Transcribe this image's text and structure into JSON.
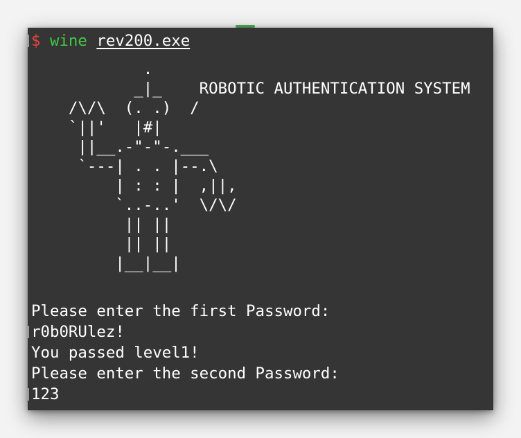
{
  "terminal": {
    "prompt_symbol": "$",
    "command": "wine",
    "argument": "rev200.exe",
    "banner_lines": [
      "            .",
      "           _|_    ROBOTIC AUTHENTICATION SYSTEM",
      "    /\\/\\  (. .)  /",
      "    `||'   |#|",
      "     ||__.-\"-\"-.___",
      "     `---| . . |--.\\",
      "         | : : |  ,||,",
      "         `..-..'  \\/\\/",
      "          || ||",
      "          || ||",
      "         |__|__|"
    ],
    "output_lines": [
      "Please enter the first Password:",
      "r0b0RUlez!",
      "You passed level1!",
      "Please enter the second Password:",
      "123"
    ]
  },
  "colors": {
    "terminal_bg": "#353535",
    "prompt": "#e0443e",
    "command": "#44c844",
    "text": "#ffffff"
  }
}
